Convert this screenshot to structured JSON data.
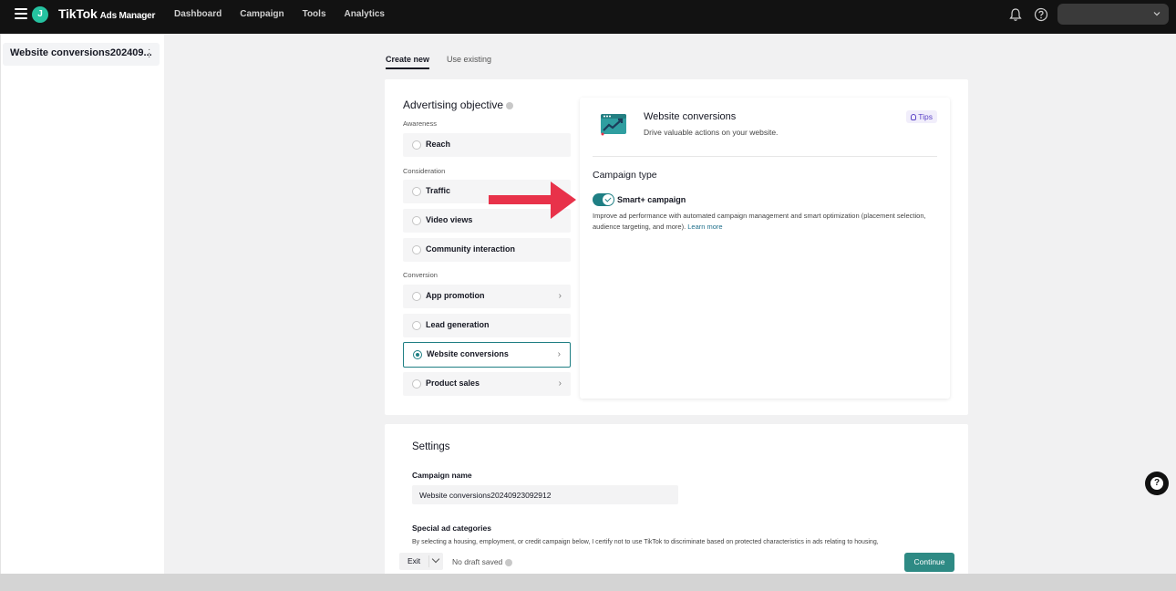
{
  "topbar": {
    "avatar_letter": "J",
    "brand": "TikTok",
    "brand_sub": "Ads Manager",
    "nav": [
      "Dashboard",
      "Campaign",
      "Tools",
      "Analytics"
    ]
  },
  "sidebar": {
    "campaign_name": "Website conversions202409..."
  },
  "tabs": [
    "Create new",
    "Use existing"
  ],
  "objective": {
    "title": "Advertising objective",
    "groups": {
      "awareness": "Awareness",
      "consideration": "Consideration",
      "conversion": "Conversion"
    },
    "options": {
      "reach": "Reach",
      "traffic": "Traffic",
      "video_views": "Video views",
      "community": "Community interaction",
      "app_promotion": "App promotion",
      "lead_generation": "Lead generation",
      "website_conversions": "Website conversions",
      "product_sales": "Product sales"
    },
    "selected": "website_conversions"
  },
  "detail": {
    "title": "Website conversions",
    "description": "Drive valuable actions on your website.",
    "tips": "Tips",
    "campaign_type_title": "Campaign type",
    "smart_label": "Smart+ campaign",
    "smart_enabled": true,
    "smart_desc": "Improve ad performance with automated campaign management and smart optimization (placement selection, audience targeting, and more).",
    "learn_more": "Learn more"
  },
  "settings": {
    "title": "Settings",
    "campaign_name_label": "Campaign name",
    "campaign_name_value": "Website conversions20240923092912",
    "special_ad_label": "Special ad categories",
    "special_ad_text": "By selecting a housing, employment, or credit campaign below, I certify not to use TikTok to discriminate based on protected characteristics in ads relating to housing,"
  },
  "actionbar": {
    "exit": "Exit",
    "draft": "No draft saved",
    "continue": "Continue"
  },
  "colors": {
    "accent": "#1f7f84",
    "continue": "#2e8a84",
    "arrow": "#e8324a",
    "topbar": "#121212"
  }
}
